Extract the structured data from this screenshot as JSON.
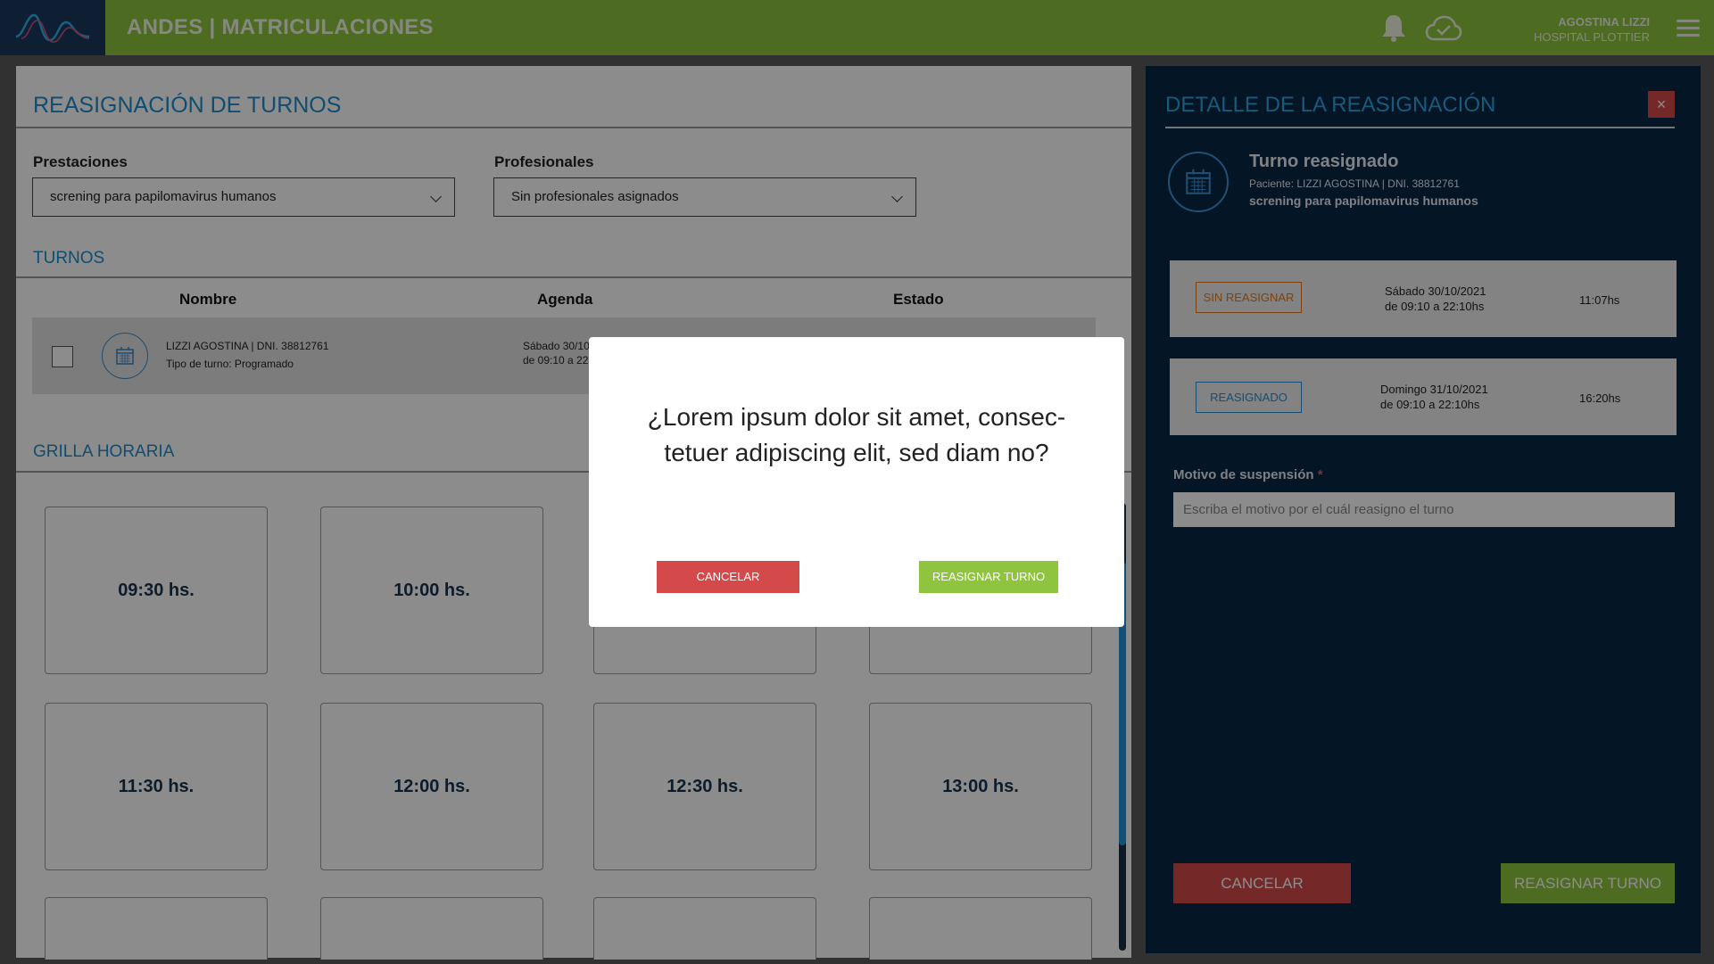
{
  "header": {
    "app_title": "ANDES | MATRICULACIONES",
    "user_name": "AGOSTINA LIZZI",
    "hospital": "HOSPITAL PLOTTIER",
    "icons": [
      "andes-logo-icon",
      "bell-icon",
      "cloud-check-icon",
      "menu-icon"
    ]
  },
  "main": {
    "title": "REASIGNACIÓN DE TURNOS",
    "prestaciones_label": "Prestaciones",
    "prestaciones_value": "screning para papilomavirus humanos",
    "profesionales_label": "Profesionales",
    "profesionales_value": "Sin profesionales asignados",
    "turnos_title": "TURNOS",
    "columns": [
      "Nombre",
      "Agenda",
      "Estado"
    ],
    "row": {
      "patient": "LIZZI AGOSTINA | DNI. 38812761",
      "type": "Tipo de turno: Programado",
      "agenda_date": "Sábado 30/10",
      "agenda_time": "de 09:10 a 22:"
    },
    "grilla_title": "GRILLA HORARIA",
    "slots_row1": [
      "09:30 hs.",
      "10:00 hs.",
      "",
      ""
    ],
    "slots_row2": [
      "11:30 hs.",
      "12:00 hs.",
      "12:30 hs.",
      "13:00 hs."
    ]
  },
  "detail": {
    "title": "DETALLE DE LA REASIGNACIÓN",
    "close": "×",
    "heading": "Turno reasignado",
    "patient": "Paciente: LIZZI AGOSTINA | DNI. 38812761",
    "prestacion": "screning para papilomavirus humanos",
    "card1": {
      "status": "SIN REASIGNAR",
      "date": "Sábado 30/10/2021",
      "range": "de 09:10 a 22:10hs",
      "time": "11:07hs",
      "color": "#e07b22"
    },
    "card2": {
      "status": "REASIGNADO",
      "date": "Domingo 31/10/2021",
      "range": "de 09:10 a 22:10hs",
      "time": "16:20hs",
      "color": "#2a8ed0"
    },
    "motivo_label": "Motivo de suspensión",
    "motivo_required": "*",
    "motivo_placeholder": "Escriba el motivo por el cuál reasigno el turno",
    "cancel": "CANCELAR",
    "confirm": "REASIGNAR TURNO"
  },
  "modal": {
    "question_line1": "¿Lorem ipsum dolor sit amet, consec-",
    "question_line2": "tetuer adipiscing elit, sed diam no?",
    "cancel": "CANCELAR",
    "confirm": "REASIGNAR TURNO"
  },
  "colors": {
    "header_green": "#8fc43f",
    "accent_blue": "#1f8ccc",
    "panel_navy": "#082746",
    "danger_red": "#d44a4a",
    "confirm_green": "#8fc43f"
  }
}
